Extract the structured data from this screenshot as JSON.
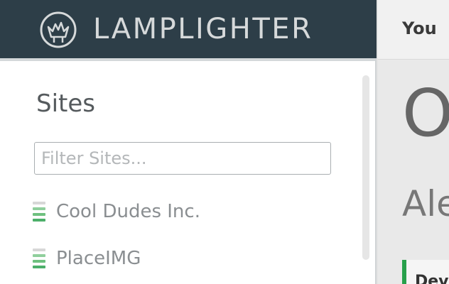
{
  "header": {
    "brand": "LAMPLIGHTER",
    "logo_icon": "lamp-flame-icon",
    "nav_link": "You"
  },
  "sidebar": {
    "title": "Sites",
    "filter_placeholder": "Filter Sites...",
    "sites": [
      {
        "label": "Cool Dudes Inc.",
        "icon": "battery-level-icon"
      },
      {
        "label": "PlaceIMG",
        "icon": "battery-level-icon"
      }
    ]
  },
  "main": {
    "heading": "O",
    "subheading": "Ale",
    "tab_label": "Dev"
  },
  "colors": {
    "brand_bar": "#2d3e48",
    "brand_text": "#d6d9da",
    "status_green": "#4caf6a",
    "accent_green": "#27a04b"
  }
}
